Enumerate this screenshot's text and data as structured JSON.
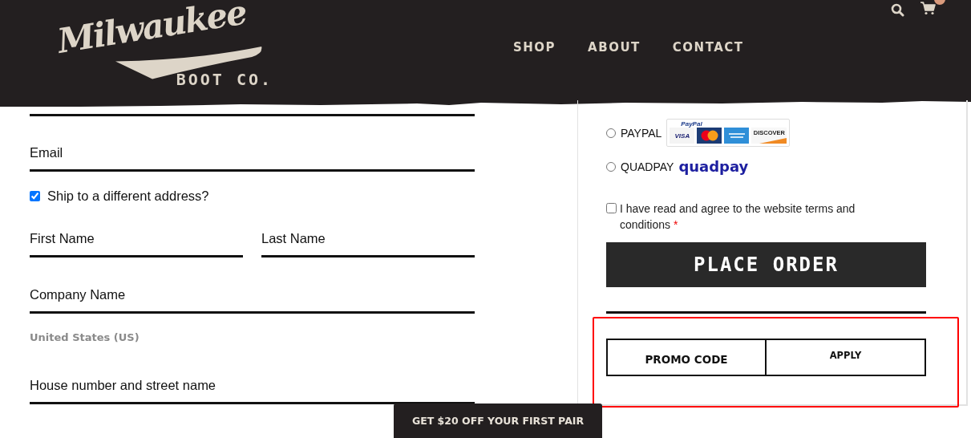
{
  "header": {
    "logo": {
      "script": "Milwaukee",
      "subtitle": "BOOT CO."
    },
    "nav": [
      {
        "label": "SHOP"
      },
      {
        "label": "ABOUT"
      },
      {
        "label": "CONTACT"
      }
    ]
  },
  "billing": {
    "email": {
      "placeholder": "Email"
    },
    "ship_to_different": {
      "label": "Ship to a different address?",
      "checked": true
    },
    "first_name": {
      "placeholder": "First Name"
    },
    "last_name": {
      "placeholder": "Last Name"
    },
    "company": {
      "placeholder": "Company Name"
    },
    "country": "United States (US)",
    "address": {
      "placeholder": "House number and street name"
    }
  },
  "payment": {
    "methods": [
      {
        "kind": "paypal",
        "label": "PAYPAL",
        "selected": false,
        "badge": {
          "brand": "PayPal",
          "cards": [
            {
              "kind": "visa",
              "label": "VISA"
            },
            {
              "kind": "mastercard"
            },
            {
              "kind": "amex"
            },
            {
              "kind": "discover",
              "label": "DISCOVER"
            }
          ]
        }
      },
      {
        "kind": "quadpay",
        "label": "QUADPAY",
        "selected": false,
        "logo": "quadpay"
      }
    ],
    "terms": {
      "label": "I have read and agree to the website terms and conditions",
      "required": "*",
      "checked": false
    },
    "place_order": "PLACE ORDER",
    "promo": {
      "placeholder": "PROMO CODE",
      "button": "APPLY"
    }
  },
  "promo_banner": "GET $20 OFF YOUR FIRST PAIR"
}
